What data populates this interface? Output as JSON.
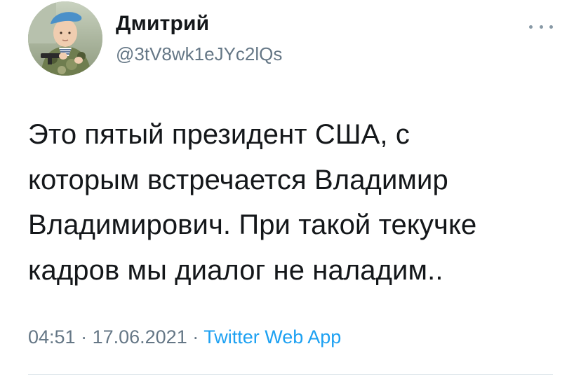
{
  "author": {
    "display_name": "Дмитрий",
    "handle": "@3tV8wk1eJYc2lQs",
    "avatar": "avatar-photo-child-in-camouflage"
  },
  "tweet": {
    "lines": [
      "Это пятый президент США, с",
      "которым встречается Владимир",
      "Владимирович. При такой текучке",
      "кадров мы диалог не наладим.."
    ]
  },
  "meta": {
    "time": "04:51",
    "separator": " · ",
    "date": "17.06.2021",
    "source": "Twitter Web App"
  },
  "icons": {
    "more": "more-horizontal-icon"
  },
  "colors": {
    "text": "#14171a",
    "secondary": "#657786",
    "link": "#1da1f2",
    "divider": "#e1e8ed"
  }
}
